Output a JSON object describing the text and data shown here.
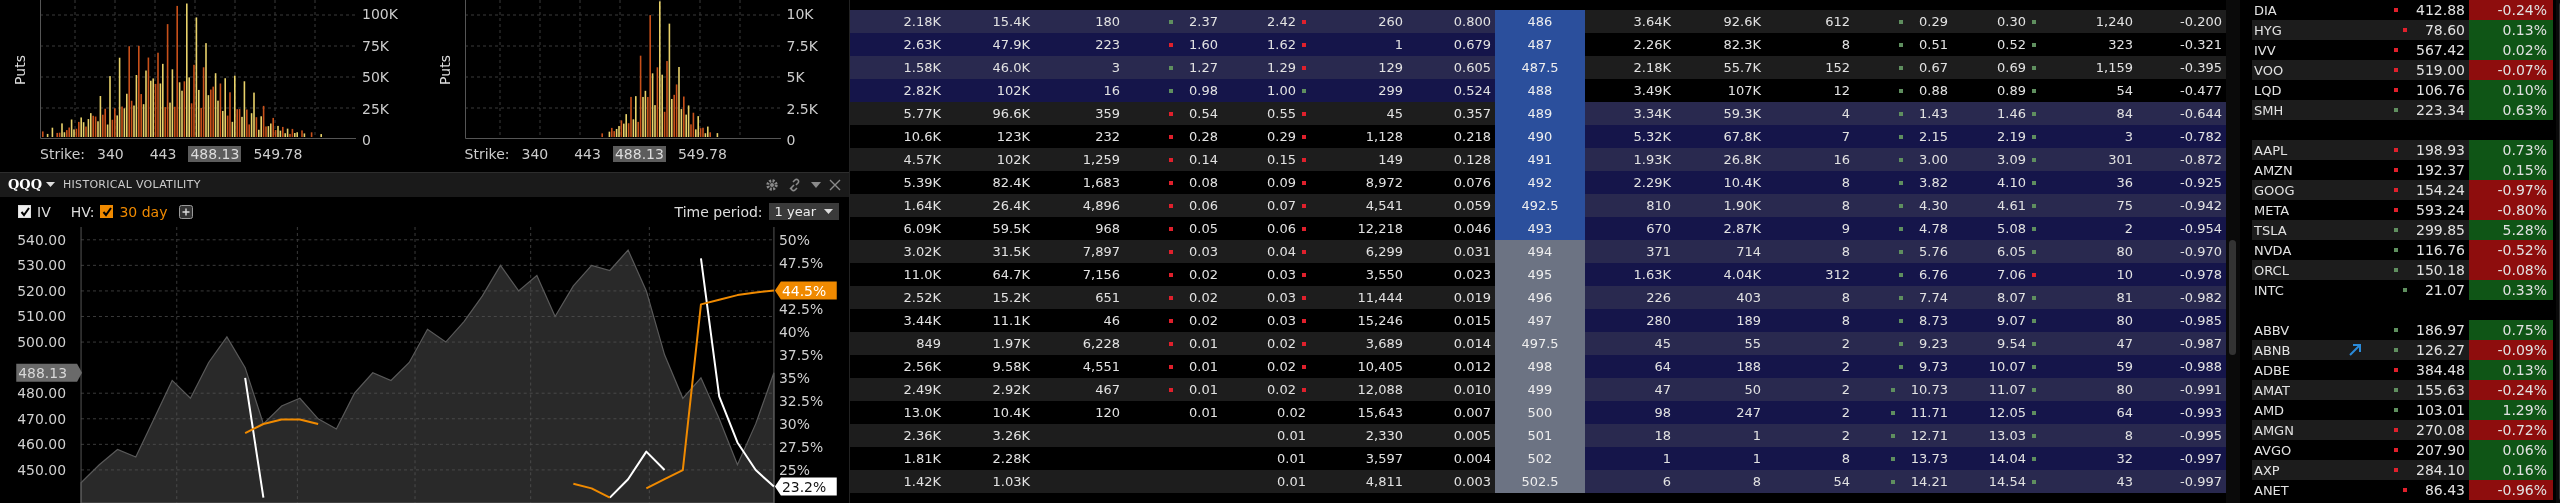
{
  "histograms": [
    {
      "axis_label": "Puts",
      "yticks": [
        "100K",
        "75K",
        "50K",
        "25K",
        "0"
      ],
      "strike_label": "Strike:",
      "strikes": [
        {
          "text": "340",
          "current": false
        },
        {
          "text": "443",
          "current": false
        },
        {
          "text": "488.13",
          "current": true
        },
        {
          "text": "549.78",
          "current": false
        }
      ]
    },
    {
      "axis_label": "Puts",
      "yticks": [
        "10K",
        "7.5K",
        "5K",
        "2.5K",
        "0"
      ],
      "strike_label": "Strike:",
      "strikes": [
        {
          "text": "340",
          "current": false
        },
        {
          "text": "443",
          "current": false
        },
        {
          "text": "488.13",
          "current": true
        },
        {
          "text": "549.78",
          "current": false
        }
      ]
    }
  ],
  "volatility_panel": {
    "symbol": "QQQ",
    "title": "HISTORICAL VOLATILITY",
    "iv_checked": true,
    "hv_label": "HV:",
    "hv_checked": true,
    "time_period_label": "Time period:",
    "time_period": "1 year",
    "chart_data": {
      "type": "area",
      "grid": true,
      "ylim": [
        437,
        545
      ],
      "yticks": [
        {
          "value": 540,
          "label": "540.00"
        },
        {
          "value": 530,
          "label": "530.00"
        },
        {
          "value": 520,
          "label": "520.00"
        },
        {
          "value": 510,
          "label": "510.00"
        },
        {
          "value": 500,
          "label": "500.00"
        },
        {
          "value": 480,
          "label": "480.00"
        },
        {
          "value": 470,
          "label": "470.00"
        },
        {
          "value": 460,
          "label": "460.00"
        },
        {
          "value": 450,
          "label": "450.00"
        }
      ],
      "y2lim": [
        21.4,
        51.4
      ],
      "y2ticks": [
        {
          "value": 50,
          "label": "50%"
        },
        {
          "value": 47.5,
          "label": "47.5%"
        },
        {
          "value": 42.5,
          "label": "42.5%"
        },
        {
          "value": 40,
          "label": "40%"
        },
        {
          "value": 37.5,
          "label": "37.5%"
        },
        {
          "value": 35,
          "label": "35%"
        },
        {
          "value": 32.5,
          "label": "32.5%"
        },
        {
          "value": 30,
          "label": "30%"
        },
        {
          "value": 27.5,
          "label": "27.5%"
        },
        {
          "value": 25,
          "label": "25%"
        }
      ],
      "series": [
        {
          "color": "#5a5a5a",
          "values": [
            445,
            452,
            458,
            455,
            470,
            485,
            478,
            492,
            502,
            490,
            468,
            475,
            478,
            470,
            466,
            480,
            488,
            485,
            492,
            505,
            500,
            508,
            518,
            530,
            520,
            526,
            510,
            522,
            530,
            528,
            536,
            520,
            495,
            478,
            486,
            470,
            452,
            468,
            488
          ]
        },
        {
          "name": "IV",
          "type": "line",
          "color": "#ffffff",
          "axis": "y2",
          "values": [
            null,
            null,
            null,
            null,
            null,
            null,
            null,
            null,
            null,
            35,
            22,
            null,
            null,
            null,
            null,
            null,
            null,
            null,
            null,
            null,
            null,
            null,
            null,
            null,
            null,
            null,
            null,
            null,
            null,
            22,
            24,
            27,
            25,
            null,
            48,
            33,
            28,
            25,
            23.2
          ]
        },
        {
          "name": "30 day",
          "type": "line",
          "color": "#f08a00",
          "axis": "y2",
          "values": [
            null,
            null,
            null,
            null,
            null,
            null,
            null,
            null,
            null,
            29,
            30,
            30.5,
            30.5,
            30,
            null,
            null,
            null,
            null,
            null,
            null,
            null,
            null,
            null,
            null,
            null,
            null,
            null,
            23.5,
            23,
            22,
            null,
            23,
            24,
            25,
            43,
            43.5,
            44,
            44.3,
            44.5
          ]
        }
      ],
      "annotations": [
        "488.13",
        "44.5%",
        "23.2%"
      ]
    }
  },
  "options": {
    "rows": [
      {
        "call": {
          "cells": [
            "2.18K",
            "15.4K",
            "180"
          ],
          "bid": "2.37",
          "bid_up": true,
          "ask": "2.42",
          "ask_up": false,
          "tail": [
            "260",
            "0.800"
          ],
          "itm": true
        },
        "strike": "486",
        "strike_near": true,
        "put": {
          "cells": [
            "3.64K",
            "92.6K",
            "612"
          ],
          "bid": "0.29",
          "bid_up": true,
          "ask": "0.30",
          "ask_up": true,
          "tail": [
            "1,240",
            "-0.200"
          ],
          "itm": false
        }
      },
      {
        "call": {
          "cells": [
            "2.63K",
            "47.9K",
            "223"
          ],
          "bid": "1.60",
          "bid_up": false,
          "ask": "1.62",
          "ask_up": false,
          "tail": [
            "1",
            "0.679"
          ],
          "itm": true
        },
        "strike": "487",
        "strike_near": true,
        "put": {
          "cells": [
            "2.26K",
            "82.3K",
            "8"
          ],
          "bid": "0.51",
          "bid_up": true,
          "ask": "0.52",
          "ask_up": true,
          "tail": [
            "323",
            "-0.321"
          ],
          "itm": false
        }
      },
      {
        "call": {
          "cells": [
            "1.58K",
            "46.0K",
            "3"
          ],
          "bid": "1.27",
          "bid_up": true,
          "ask": "1.29",
          "ask_up": false,
          "tail": [
            "129",
            "0.605"
          ],
          "itm": true
        },
        "strike": "487.5",
        "strike_near": true,
        "put": {
          "cells": [
            "2.18K",
            "55.7K",
            "152"
          ],
          "bid": "0.67",
          "bid_up": true,
          "ask": "0.69",
          "ask_up": true,
          "tail": [
            "1,159",
            "-0.395"
          ],
          "itm": false
        }
      },
      {
        "call": {
          "cells": [
            "2.82K",
            "102K",
            "16"
          ],
          "bid": "0.98",
          "bid_up": true,
          "ask": "1.00",
          "ask_up": true,
          "tail": [
            "299",
            "0.524"
          ],
          "itm": true
        },
        "strike": "488",
        "strike_near": true,
        "put": {
          "cells": [
            "3.49K",
            "107K",
            "12"
          ],
          "bid": "0.88",
          "bid_up": true,
          "ask": "0.89",
          "ask_up": true,
          "tail": [
            "54",
            "-0.477"
          ],
          "itm": false
        }
      },
      {
        "call": {
          "cells": [
            "5.77K",
            "96.6K",
            "359"
          ],
          "bid": "0.54",
          "bid_up": false,
          "ask": "0.55",
          "ask_up": false,
          "tail": [
            "45",
            "0.357"
          ],
          "itm": false
        },
        "strike": "489",
        "strike_near": true,
        "put": {
          "cells": [
            "3.34K",
            "59.3K",
            "4"
          ],
          "bid": "1.43",
          "bid_up": true,
          "ask": "1.46",
          "ask_up": true,
          "tail": [
            "84",
            "-0.644"
          ],
          "itm": true
        }
      },
      {
        "call": {
          "cells": [
            "10.6K",
            "123K",
            "232"
          ],
          "bid": "0.28",
          "bid_up": false,
          "ask": "0.29",
          "ask_up": false,
          "tail": [
            "1,128",
            "0.218"
          ],
          "itm": false
        },
        "strike": "490",
        "strike_near": true,
        "put": {
          "cells": [
            "5.32K",
            "67.8K",
            "7"
          ],
          "bid": "2.15",
          "bid_up": true,
          "ask": "2.19",
          "ask_up": true,
          "tail": [
            "3",
            "-0.782"
          ],
          "itm": true
        }
      },
      {
        "call": {
          "cells": [
            "4.57K",
            "102K",
            "1,259"
          ],
          "bid": "0.14",
          "bid_up": false,
          "ask": "0.15",
          "ask_up": false,
          "tail": [
            "149",
            "0.128"
          ],
          "itm": false
        },
        "strike": "491",
        "strike_near": true,
        "put": {
          "cells": [
            "1.93K",
            "26.8K",
            "16"
          ],
          "bid": "3.00",
          "bid_up": true,
          "ask": "3.09",
          "ask_up": true,
          "tail": [
            "301",
            "-0.872"
          ],
          "itm": true
        }
      },
      {
        "call": {
          "cells": [
            "5.39K",
            "82.4K",
            "1,683"
          ],
          "bid": "0.08",
          "bid_up": false,
          "ask": "0.09",
          "ask_up": false,
          "tail": [
            "8,972",
            "0.076"
          ],
          "itm": false
        },
        "strike": "492",
        "strike_near": true,
        "put": {
          "cells": [
            "2.29K",
            "10.4K",
            "8"
          ],
          "bid": "3.82",
          "bid_up": true,
          "ask": "4.10",
          "ask_up": true,
          "tail": [
            "36",
            "-0.925"
          ],
          "itm": true
        }
      },
      {
        "call": {
          "cells": [
            "1.64K",
            "26.4K",
            "4,896"
          ],
          "bid": "0.06",
          "bid_up": false,
          "ask": "0.07",
          "ask_up": false,
          "tail": [
            "4,541",
            "0.059"
          ],
          "itm": false
        },
        "strike": "492.5",
        "strike_near": true,
        "put": {
          "cells": [
            "810",
            "1.90K",
            "8"
          ],
          "bid": "4.30",
          "bid_up": true,
          "ask": "4.61",
          "ask_up": true,
          "tail": [
            "75",
            "-0.942"
          ],
          "itm": true
        }
      },
      {
        "call": {
          "cells": [
            "6.09K",
            "59.5K",
            "968"
          ],
          "bid": "0.05",
          "bid_up": false,
          "ask": "0.06",
          "ask_up": false,
          "tail": [
            "12,218",
            "0.046"
          ],
          "itm": false
        },
        "strike": "493",
        "strike_near": true,
        "put": {
          "cells": [
            "670",
            "2.87K",
            "9"
          ],
          "bid": "4.78",
          "bid_up": true,
          "ask": "5.08",
          "ask_up": true,
          "tail": [
            "2",
            "-0.954"
          ],
          "itm": true
        }
      },
      {
        "call": {
          "cells": [
            "3.02K",
            "31.5K",
            "7,897"
          ],
          "bid": "0.03",
          "bid_up": false,
          "ask": "0.04",
          "ask_up": false,
          "tail": [
            "6,299",
            "0.031"
          ],
          "itm": false
        },
        "strike": "494",
        "strike_near": false,
        "put": {
          "cells": [
            "371",
            "714",
            "8"
          ],
          "bid": "5.76",
          "bid_up": true,
          "ask": "6.05",
          "ask_up": true,
          "tail": [
            "80",
            "-0.970"
          ],
          "itm": true
        }
      },
      {
        "call": {
          "cells": [
            "11.0K",
            "64.7K",
            "7,156"
          ],
          "bid": "0.02",
          "bid_up": false,
          "ask": "0.03",
          "ask_up": false,
          "tail": [
            "3,550",
            "0.023"
          ],
          "itm": false
        },
        "strike": "495",
        "strike_near": false,
        "put": {
          "cells": [
            "1.63K",
            "4.04K",
            "312"
          ],
          "bid": "6.76",
          "bid_up": true,
          "ask": "7.06",
          "ask_up": false,
          "tail": [
            "10",
            "-0.978"
          ],
          "itm": true
        }
      },
      {
        "call": {
          "cells": [
            "2.52K",
            "15.2K",
            "651"
          ],
          "bid": "0.02",
          "bid_up": false,
          "ask": "0.03",
          "ask_up": false,
          "tail": [
            "11,444",
            "0.019"
          ],
          "itm": false
        },
        "strike": "496",
        "strike_near": false,
        "put": {
          "cells": [
            "226",
            "403",
            "8"
          ],
          "bid": "7.74",
          "bid_up": true,
          "ask": "8.07",
          "ask_up": true,
          "tail": [
            "81",
            "-0.982"
          ],
          "itm": true
        }
      },
      {
        "call": {
          "cells": [
            "3.44K",
            "11.1K",
            "46"
          ],
          "bid": "0.02",
          "bid_up": false,
          "ask": "0.03",
          "ask_up": false,
          "tail": [
            "15,246",
            "0.015"
          ],
          "itm": false
        },
        "strike": "497",
        "strike_near": false,
        "put": {
          "cells": [
            "280",
            "189",
            "8"
          ],
          "bid": "8.73",
          "bid_up": true,
          "ask": "9.07",
          "ask_up": true,
          "tail": [
            "80",
            "-0.985"
          ],
          "itm": true
        }
      },
      {
        "call": {
          "cells": [
            "849",
            "1.97K",
            "6,228"
          ],
          "bid": "0.01",
          "bid_up": false,
          "ask": "0.02",
          "ask_up": false,
          "tail": [
            "3,689",
            "0.014"
          ],
          "itm": false
        },
        "strike": "497.5",
        "strike_near": false,
        "put": {
          "cells": [
            "45",
            "55",
            "2"
          ],
          "bid": "9.23",
          "bid_up": true,
          "ask": "9.54",
          "ask_up": true,
          "tail": [
            "47",
            "-0.987"
          ],
          "itm": true
        }
      },
      {
        "call": {
          "cells": [
            "2.56K",
            "9.58K",
            "4,551"
          ],
          "bid": "0.01",
          "bid_up": false,
          "ask": "0.02",
          "ask_up": false,
          "tail": [
            "10,405",
            "0.012"
          ],
          "itm": false
        },
        "strike": "498",
        "strike_near": false,
        "put": {
          "cells": [
            "64",
            "188",
            "2"
          ],
          "bid": "9.73",
          "bid_up": true,
          "ask": "10.07",
          "ask_up": true,
          "tail": [
            "59",
            "-0.988"
          ],
          "itm": true
        }
      },
      {
        "call": {
          "cells": [
            "2.49K",
            "2.92K",
            "467"
          ],
          "bid": "0.01",
          "bid_up": false,
          "ask": "0.02",
          "ask_up": false,
          "tail": [
            "12,088",
            "0.010"
          ],
          "itm": false
        },
        "strike": "499",
        "strike_near": false,
        "put": {
          "cells": [
            "47",
            "50",
            "2"
          ],
          "bid": "10.73",
          "bid_up": true,
          "ask": "11.07",
          "ask_up": true,
          "tail": [
            "80",
            "-0.991"
          ],
          "itm": true
        }
      },
      {
        "call": {
          "cells": [
            "13.0K",
            "10.4K",
            "120"
          ],
          "bid": "0.01",
          "ask": "0.02",
          "tail": [
            "15,643",
            "0.007"
          ],
          "itm": false
        },
        "strike": "500",
        "strike_near": false,
        "put": {
          "cells": [
            "98",
            "247",
            "2"
          ],
          "bid": "11.71",
          "bid_up": true,
          "ask": "12.05",
          "ask_up": true,
          "tail": [
            "64",
            "-0.993"
          ],
          "itm": true
        }
      },
      {
        "call": {
          "cells": [
            "2.36K",
            "3.26K"
          ],
          "ask": "0.01",
          "tail": [
            "2,330",
            "0.005"
          ],
          "itm": false
        },
        "strike": "501",
        "strike_near": false,
        "put": {
          "cells": [
            "18",
            "1",
            "2"
          ],
          "bid": "12.71",
          "bid_up": true,
          "ask": "13.03",
          "ask_up": true,
          "tail": [
            "8",
            "-0.995"
          ],
          "itm": true
        }
      },
      {
        "call": {
          "cells": [
            "1.81K",
            "2.28K"
          ],
          "ask": "0.01",
          "tail": [
            "3,597",
            "0.004"
          ],
          "itm": false
        },
        "strike": "502",
        "strike_near": false,
        "put": {
          "cells": [
            "1",
            "1",
            "8"
          ],
          "bid": "13.73",
          "bid_up": true,
          "ask": "14.04",
          "ask_up": true,
          "tail": [
            "32",
            "-0.997"
          ],
          "itm": true
        }
      },
      {
        "call": {
          "cells": [
            "1.42K",
            "1.03K"
          ],
          "ask": "0.01",
          "tail": [
            "4,811",
            "0.003"
          ],
          "itm": false
        },
        "strike": "502.5",
        "strike_near": false,
        "put": {
          "cells": [
            "6",
            "8",
            "54"
          ],
          "bid": "14.21",
          "bid_up": true,
          "ask": "14.54",
          "ask_up": true,
          "tail": [
            "43",
            "-0.997"
          ],
          "itm": true
        }
      }
    ]
  },
  "watchlist": {
    "groups": [
      {
        "rows": [
          {
            "symbol": "DIA",
            "arrow": false,
            "tick_up": false,
            "price": "412.88",
            "change": "-0.24%",
            "change_up": false
          },
          {
            "symbol": "HYG",
            "arrow": false,
            "tick_up": false,
            "price": "78.60",
            "change": "0.13%",
            "change_up": true
          },
          {
            "symbol": "IVV",
            "arrow": false,
            "tick_up": false,
            "price": "567.42",
            "change": "0.02%",
            "change_up": true
          },
          {
            "symbol": "VOO",
            "arrow": false,
            "tick_up": false,
            "price": "519.00",
            "change": "-0.07%",
            "change_up": false
          },
          {
            "symbol": "LQD",
            "arrow": false,
            "tick_up": false,
            "price": "106.76",
            "change": "0.10%",
            "change_up": true
          },
          {
            "symbol": "SMH",
            "arrow": false,
            "tick_up": true,
            "price": "223.34",
            "change": "0.63%",
            "change_up": true
          }
        ]
      },
      {
        "rows": [
          {
            "symbol": "AAPL",
            "arrow": false,
            "tick_up": false,
            "price": "198.93",
            "change": "0.73%",
            "change_up": true
          },
          {
            "symbol": "AMZN",
            "arrow": false,
            "tick_up": false,
            "price": "192.37",
            "change": "0.15%",
            "change_up": true
          },
          {
            "symbol": "GOOG",
            "arrow": false,
            "tick_up": false,
            "price": "154.24",
            "change": "-0.97%",
            "change_up": false
          },
          {
            "symbol": "META",
            "arrow": false,
            "tick_up": false,
            "price": "593.24",
            "change": "-0.80%",
            "change_up": false
          },
          {
            "symbol": "TSLA",
            "arrow": false,
            "tick_up": true,
            "price": "299.85",
            "change": "5.28%",
            "change_up": true
          },
          {
            "symbol": "NVDA",
            "arrow": false,
            "tick_up": true,
            "price": "116.76",
            "change": "-0.52%",
            "change_up": false
          },
          {
            "symbol": "ORCL",
            "arrow": false,
            "tick_up": true,
            "price": "150.18",
            "change": "-0.08%",
            "change_up": false
          },
          {
            "symbol": "INTC",
            "arrow": false,
            "tick_up": true,
            "price": "21.07",
            "change": "0.33%",
            "change_up": true
          }
        ]
      },
      {
        "rows": [
          {
            "symbol": "ABBV",
            "arrow": false,
            "tick_up": true,
            "price": "186.97",
            "change": "0.75%",
            "change_up": true
          },
          {
            "symbol": "ABNB",
            "arrow": true,
            "tick_up": true,
            "price": "126.27",
            "change": "-0.09%",
            "change_up": false
          },
          {
            "symbol": "ADBE",
            "arrow": false,
            "tick_up": false,
            "price": "384.48",
            "change": "0.13%",
            "change_up": true
          },
          {
            "symbol": "AMAT",
            "arrow": false,
            "tick_up": true,
            "price": "155.63",
            "change": "-0.24%",
            "change_up": false
          },
          {
            "symbol": "AMD",
            "arrow": false,
            "tick_up": true,
            "price": "103.01",
            "change": "1.29%",
            "change_up": true
          },
          {
            "symbol": "AMGN",
            "arrow": false,
            "tick_up": false,
            "price": "270.08",
            "change": "-0.72%",
            "change_up": false
          },
          {
            "symbol": "AVGO",
            "arrow": false,
            "tick_up": false,
            "price": "207.90",
            "change": "0.06%",
            "change_up": true
          },
          {
            "symbol": "AXP",
            "arrow": false,
            "tick_up": false,
            "price": "284.10",
            "change": "0.16%",
            "change_up": true
          },
          {
            "symbol": "ANET",
            "arrow": false,
            "tick_up": false,
            "price": "86.43",
            "change": "-0.96%",
            "change_up": false
          }
        ]
      }
    ]
  }
}
